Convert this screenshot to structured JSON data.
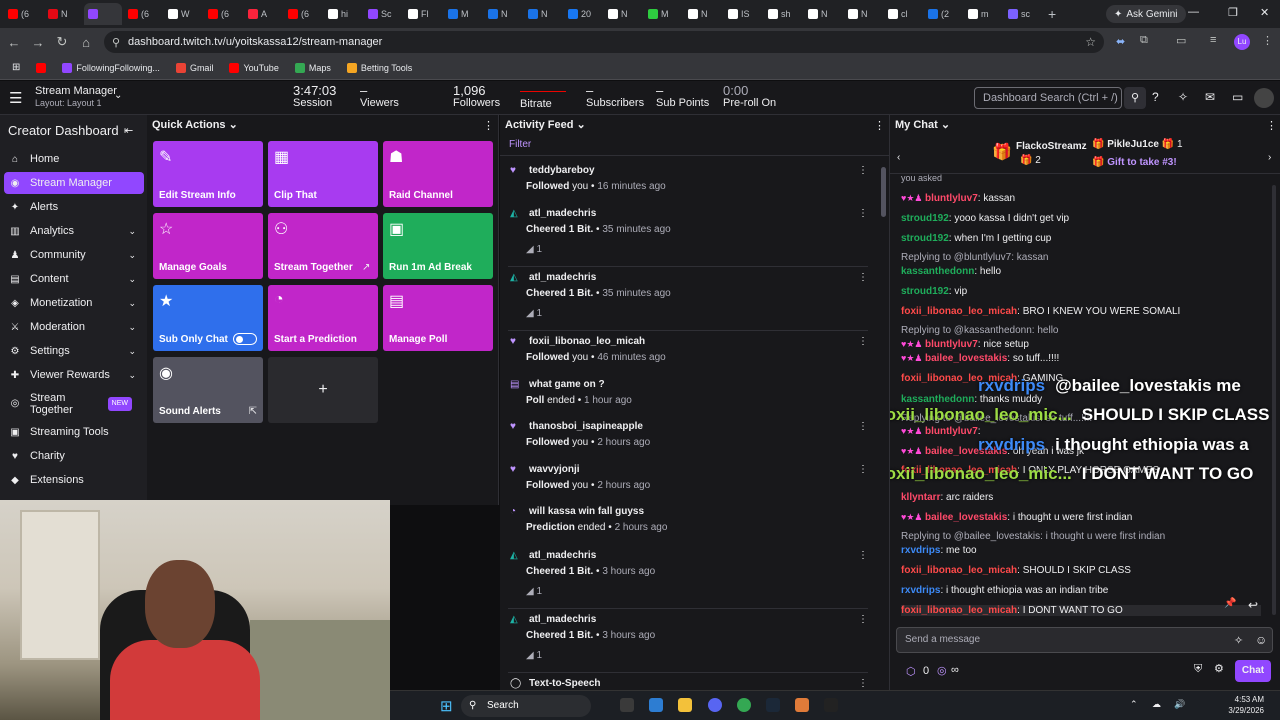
{
  "browser": {
    "tabs": [
      {
        "label": "(6",
        "color": "#ff0000"
      },
      {
        "label": "N",
        "color": "#e50914"
      },
      {
        "label": "",
        "color": "#9147ff",
        "active": true
      },
      {
        "label": "(6",
        "color": "#ff0000"
      },
      {
        "label": "W",
        "color": "#ffffff"
      },
      {
        "label": "(6",
        "color": "#ff0000"
      },
      {
        "label": "A",
        "color": "#fa243c"
      },
      {
        "label": "(6",
        "color": "#ff0000"
      },
      {
        "label": "hi",
        "color": "#ffffff"
      },
      {
        "label": "Sc",
        "color": "#9147ff"
      },
      {
        "label": "Fl",
        "color": "#ffffff"
      },
      {
        "label": "M",
        "color": "#1a73e8"
      },
      {
        "label": "N",
        "color": "#1a73e8"
      },
      {
        "label": "N",
        "color": "#1a73e8"
      },
      {
        "label": "20",
        "color": "#1877f2"
      },
      {
        "label": "N",
        "color": "#ffffff"
      },
      {
        "label": "M",
        "color": "#2ecc40"
      },
      {
        "label": "N",
        "color": "#ffffff"
      },
      {
        "label": "IS",
        "color": "#ffffff"
      },
      {
        "label": "sh",
        "color": "#ffffff"
      },
      {
        "label": "N",
        "color": "#ffffff"
      },
      {
        "label": "N",
        "color": "#ffffff"
      },
      {
        "label": "cl",
        "color": "#ffffff"
      },
      {
        "label": "(2",
        "color": "#1a73e8"
      },
      {
        "label": "m",
        "color": "#ffffff"
      },
      {
        "label": "sc",
        "color": "#7b61ff"
      }
    ],
    "new_tab": "+",
    "gemini": "Ask Gemini",
    "url": "dashboard.twitch.tv/u/yoitskassa12/stream-manager",
    "bookmarks": [
      "FollowingFollowing...",
      "Gmail",
      "YouTube",
      "Maps",
      "Betting Tools"
    ],
    "profile": "Lu"
  },
  "topbar": {
    "title": "Stream Manager",
    "layout": "Layout: Layout 1",
    "stats": [
      {
        "value": "3:47:03",
        "label": "Session"
      },
      {
        "value": "–",
        "label": "Viewers"
      },
      {
        "value": "1,096",
        "label": "Followers"
      },
      {
        "value": "",
        "label": "Bitrate"
      },
      {
        "value": "–",
        "label": "Subscribers"
      },
      {
        "value": "–",
        "label": "Sub Points"
      },
      {
        "value": "0:00",
        "label": "Pre-roll On"
      }
    ],
    "search_placeholder": "Dashboard Search (Ctrl + /)"
  },
  "leftnav": {
    "title": "Creator Dashboard",
    "items": [
      {
        "label": "Home",
        "icon": "home-icon"
      },
      {
        "label": "Stream Manager",
        "icon": "broadcast-icon",
        "selected": true
      },
      {
        "label": "Alerts",
        "icon": "bell-icon"
      },
      {
        "label": "Analytics",
        "icon": "chart-icon",
        "chevron": true
      },
      {
        "label": "Community",
        "icon": "people-icon",
        "chevron": true
      },
      {
        "label": "Content",
        "icon": "content-icon",
        "chevron": true
      },
      {
        "label": "Monetization",
        "icon": "money-icon",
        "chevron": true
      },
      {
        "label": "Moderation",
        "icon": "sword-icon",
        "chevron": true
      },
      {
        "label": "Settings",
        "icon": "gear-icon",
        "chevron": true
      },
      {
        "label": "Viewer Rewards",
        "icon": "gift-icon",
        "chevron": true
      },
      {
        "label": "Stream Together",
        "icon": "together-icon",
        "badge": "NEW"
      },
      {
        "label": "Streaming Tools",
        "icon": "tools-icon"
      },
      {
        "label": "Charity",
        "icon": "heart-icon"
      },
      {
        "label": "Extensions",
        "icon": "puzzle-icon"
      }
    ]
  },
  "quick_actions": {
    "title": "Quick Actions",
    "tiles": [
      {
        "label": "Edit Stream Info",
        "icon": "pencil-icon"
      },
      {
        "label": "Clip That",
        "icon": "clapper-icon"
      },
      {
        "label": "Raid Channel",
        "icon": "raid-icon"
      },
      {
        "label": "Manage Goals",
        "icon": "star-outline-icon"
      },
      {
        "label": "Stream Together",
        "icon": "person-add-icon"
      },
      {
        "label": "Run 1m Ad Break",
        "icon": "ad-icon"
      },
      {
        "label": "Sub Only Chat",
        "icon": "star-icon"
      },
      {
        "label": "Start a Prediction",
        "icon": "prediction-icon"
      },
      {
        "label": "Manage Poll",
        "icon": "poll-icon"
      },
      {
        "label": "Sound Alerts",
        "icon": "sound-alerts-icon"
      },
      {
        "label": "+",
        "icon": "plus-icon"
      }
    ]
  },
  "activity_feed": {
    "title": "Activity Feed",
    "filter": "Filter",
    "items": [
      {
        "name": "teddybareboy",
        "action": "Followed",
        "rest": " you",
        "time": "16 minutes ago",
        "type": "follow"
      },
      {
        "name": "atl_madechris",
        "action": "Cheered 1 Bit.",
        "rest": "",
        "time": "35 minutes ago",
        "type": "cheer",
        "bits": "1"
      },
      {
        "name": "atl_madechris",
        "action": "Cheered 1 Bit.",
        "rest": "",
        "time": "35 minutes ago",
        "type": "cheer",
        "bits": "1"
      },
      {
        "name": "foxii_libonao_leo_micah",
        "action": "Followed",
        "rest": " you",
        "time": "46 minutes ago",
        "type": "follow"
      },
      {
        "name": "what game on ?",
        "action": "Poll",
        "rest": " ended",
        "time": "1 hour ago",
        "type": "poll"
      },
      {
        "name": "thanosboi_isapineapple",
        "action": "Followed",
        "rest": " you",
        "time": "2 hours ago",
        "type": "follow"
      },
      {
        "name": "wavvyjonji",
        "action": "Followed",
        "rest": " you",
        "time": "2 hours ago",
        "type": "follow"
      },
      {
        "name": "will kassa win fall guyss",
        "action": "Prediction",
        "rest": " ended",
        "time": "2 hours ago",
        "type": "prediction"
      },
      {
        "name": "atl_madechris",
        "action": "Cheered 1 Bit.",
        "rest": "",
        "time": "3 hours ago",
        "type": "cheer",
        "bits": "1"
      },
      {
        "name": "atl_madechris",
        "action": "Cheered 1 Bit.",
        "rest": "",
        "time": "3 hours ago",
        "type": "cheer",
        "bits": "1"
      },
      {
        "name": "Text-to-Speech",
        "action": "",
        "rest": "",
        "time": "",
        "type": "tts"
      }
    ]
  },
  "chat": {
    "title": "My Chat",
    "gifters": [
      {
        "name": "FlackoStreamz",
        "count": "2"
      },
      {
        "name": "PikleJu1ce",
        "count": "1"
      }
    ],
    "gift_cta": "Gift to take #3!",
    "top_partial": "you asked",
    "messages": [
      {
        "user": "bluntlyluv7",
        "color": "#ff4a6a",
        "text": "kassan",
        "badges": true
      },
      {
        "user": "stroud192",
        "color": "#1fad5b",
        "text": "yooo kassa I didn't get vip"
      },
      {
        "user": "stroud192",
        "color": "#1fad5b",
        "text": "when I'm I getting cup"
      },
      {
        "reply": "Replying to @bluntlyluv7: kassan"
      },
      {
        "user": "kassanthedonn",
        "color": "#1fad5b",
        "text": "hello"
      },
      {
        "user": "stroud192",
        "color": "#1fad5b",
        "text": "vip"
      },
      {
        "user": "foxii_libonao_leo_micah",
        "color": "#ff4a4a",
        "text": "BRO I KNEW YOU WERE SOMALI"
      },
      {
        "reply": "Replying to @kassanthedonn: hello"
      },
      {
        "user": "bluntlyluv7",
        "color": "#ff4a6a",
        "text": "nice setup",
        "badges": true
      },
      {
        "user": "bailee_lovestakis",
        "color": "#ff4a6a",
        "text": "so tuff...!!!!",
        "badges": true
      },
      {
        "user": "foxii_libonao_leo_micah",
        "color": "#ff4a4a",
        "text": "GAMING"
      },
      {
        "user": "kassanthedonn",
        "color": "#1fad5b",
        "text": "thanks muddy"
      },
      {
        "reply": "Replying to @bailee_lovestakis: so tuff...!!!!"
      },
      {
        "user": "bluntlyluv7",
        "color": "#ff4a6a",
        "text": "",
        "badges": true
      },
      {
        "user": "bailee_lovestakis",
        "color": "#ff4a6a",
        "text": "oh yeah i was jk",
        "badges": true
      },
      {
        "user": "foxii_libonao_leo_micah",
        "color": "#ff4a4a",
        "text": "I ONLY PLAY HORSE GAMES"
      },
      {
        "user": "kllyntarr",
        "color": "#ff4a6a",
        "text": "arc raiders"
      },
      {
        "user": "bailee_lovestakis",
        "color": "#ff4a6a",
        "text": "i thought u were first indian",
        "badges": true
      },
      {
        "reply": "Replying to @bailee_lovestakis: i thought u were first indian"
      },
      {
        "user": "rxvdrips",
        "color": "#3d8af7",
        "text": "me too"
      },
      {
        "user": "foxii_libonao_leo_micah",
        "color": "#ff4a4a",
        "text": "SHOULD I SKIP CLASS"
      },
      {
        "user": "rxvdrips",
        "color": "#3d8af7",
        "text": "i thought ethiopia was an indian tribe"
      },
      {
        "user": "foxii_libonao_leo_micah",
        "color": "#ff4a4a",
        "text": "I DONT WANT TO GO"
      }
    ],
    "overlays": [
      {
        "user": "rxvdrips",
        "text": "@bailee_lovestakis me",
        "color": "#3d8af7"
      },
      {
        "user": "foxii_libonao_leo_mic...",
        "text": "SHOULD I SKIP CLASS",
        "color": "#9ddc44"
      },
      {
        "user": "rxvdrips",
        "text": "i thought ethiopia was a",
        "color": "#3d8af7"
      },
      {
        "user": "foxii_libonao_leo_mic...",
        "text": "I DONT WANT TO GO",
        "color": "#9ddc44"
      }
    ],
    "send_placeholder": "Send a message",
    "points": "0",
    "infinity": "∞",
    "chat_button": "Chat"
  },
  "taskbar": {
    "search": "Search",
    "time": "4:53 AM",
    "date": "3/29/2026"
  }
}
